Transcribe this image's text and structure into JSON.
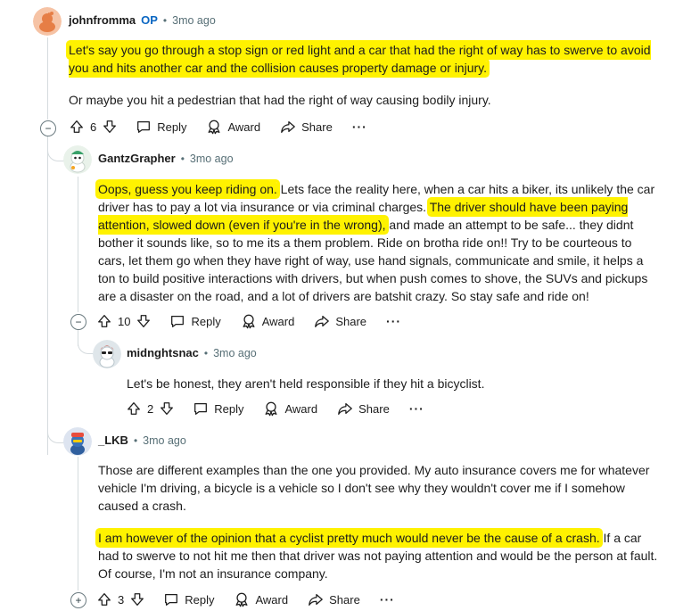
{
  "comment1": {
    "username": "johnfromma",
    "op_badge": "OP",
    "separator": "•",
    "time": "3mo ago",
    "para1": "Let's say you go through a stop sign or red light and a car that had the right of way has to swerve to avoid you and hits another car and the collision causes property damage or injury.",
    "para2": "Or maybe you hit a pedestrian that had the right of way causing bodily injury.",
    "votes": "6",
    "actions": {
      "reply": "Reply",
      "award": "Award",
      "share": "Share",
      "more": "···"
    }
  },
  "comment2": {
    "username": "GantzGrapher",
    "separator": "•",
    "time": "3mo ago",
    "hl1": "Oops, guess you keep riding on.",
    "t1": " Lets face the reality here, when a car hits a biker, its unlikely the car driver has to pay a lot via insurance or via criminal charges. ",
    "hl2": "The driver should have been paying attention, slowed down (even if you're in the wrong),",
    "t2": " and made an attempt to be safe... they didnt bother it sounds like, so to me its a them problem. Ride on brotha ride on!! Try to be courteous to cars, let them go when they have right of way, use hand signals, communicate and smile, it helps a ton to build positive interactions with drivers, but when push comes to shove, the SUVs and pickups are a disaster on the road, and a lot of drivers are batshit crazy. So stay safe and ride on!",
    "votes": "10",
    "actions": {
      "reply": "Reply",
      "award": "Award",
      "share": "Share",
      "more": "···"
    }
  },
  "comment3": {
    "username": "midnghtsnac",
    "separator": "•",
    "time": "3mo ago",
    "text": "Let's be honest, they aren't held responsible if they hit a bicyclist.",
    "votes": "2",
    "actions": {
      "reply": "Reply",
      "award": "Award",
      "share": "Share",
      "more": "···"
    }
  },
  "comment4": {
    "username": "_LKB",
    "separator": "•",
    "time": "3mo ago",
    "para1": "Those are different examples than the one you provided. My auto insurance covers me for whatever vehicle I'm driving, a bicycle is a vehicle so I don't see why they wouldn't cover me if I somehow caused a crash.",
    "hl": "I am however of the opinion that a cyclist pretty much would never be the cause of a crash.",
    "t": " If a car had to swerve to not hit me then that driver was not paying attention and would be the person at fault. Of course, I'm not an insurance company.",
    "votes": "3",
    "actions": {
      "reply": "Reply",
      "award": "Award",
      "share": "Share",
      "more": "···"
    }
  },
  "colors": {
    "highlight": "#fff200",
    "op": "#0a66c2",
    "meta": "#576f76",
    "line": "#d5dbde"
  }
}
